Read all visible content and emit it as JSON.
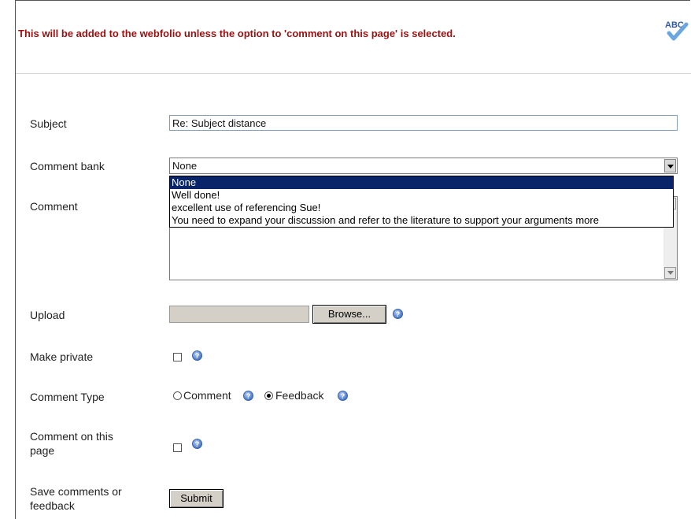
{
  "notice": "This will be added to the webfolio unless the option to 'comment on this page' is selected.",
  "spellcheck": {
    "icon": "spellcheck-icon",
    "label": "ABC"
  },
  "form": {
    "subject": {
      "label": "Subject",
      "value": "Re: Subject distance"
    },
    "comment_bank": {
      "label": "Comment bank",
      "selected": "None",
      "options": [
        "None",
        "Well done!",
        "excellent use of referencing Sue!",
        "You need to expand your discussion and refer to the literature to support your arguments more"
      ]
    },
    "comment": {
      "label": "Comment",
      "value": ""
    },
    "upload": {
      "label": "Upload",
      "browse_label": "Browse..."
    },
    "make_private": {
      "label": "Make private",
      "checked": false
    },
    "comment_type": {
      "label": "Comment Type",
      "options": [
        {
          "label": "Comment",
          "selected": false
        },
        {
          "label": "Feedback",
          "selected": true
        }
      ]
    },
    "comment_on_page": {
      "label_line1": "Comment on this",
      "label_line2": "page",
      "checked": false
    },
    "save": {
      "label_line1": "Save comments or",
      "label_line2": "feedback",
      "button_label": "Submit"
    }
  },
  "colors": {
    "notice": "#9b1111",
    "selection": "#0a246a",
    "help_icon": "#4a78c8"
  }
}
